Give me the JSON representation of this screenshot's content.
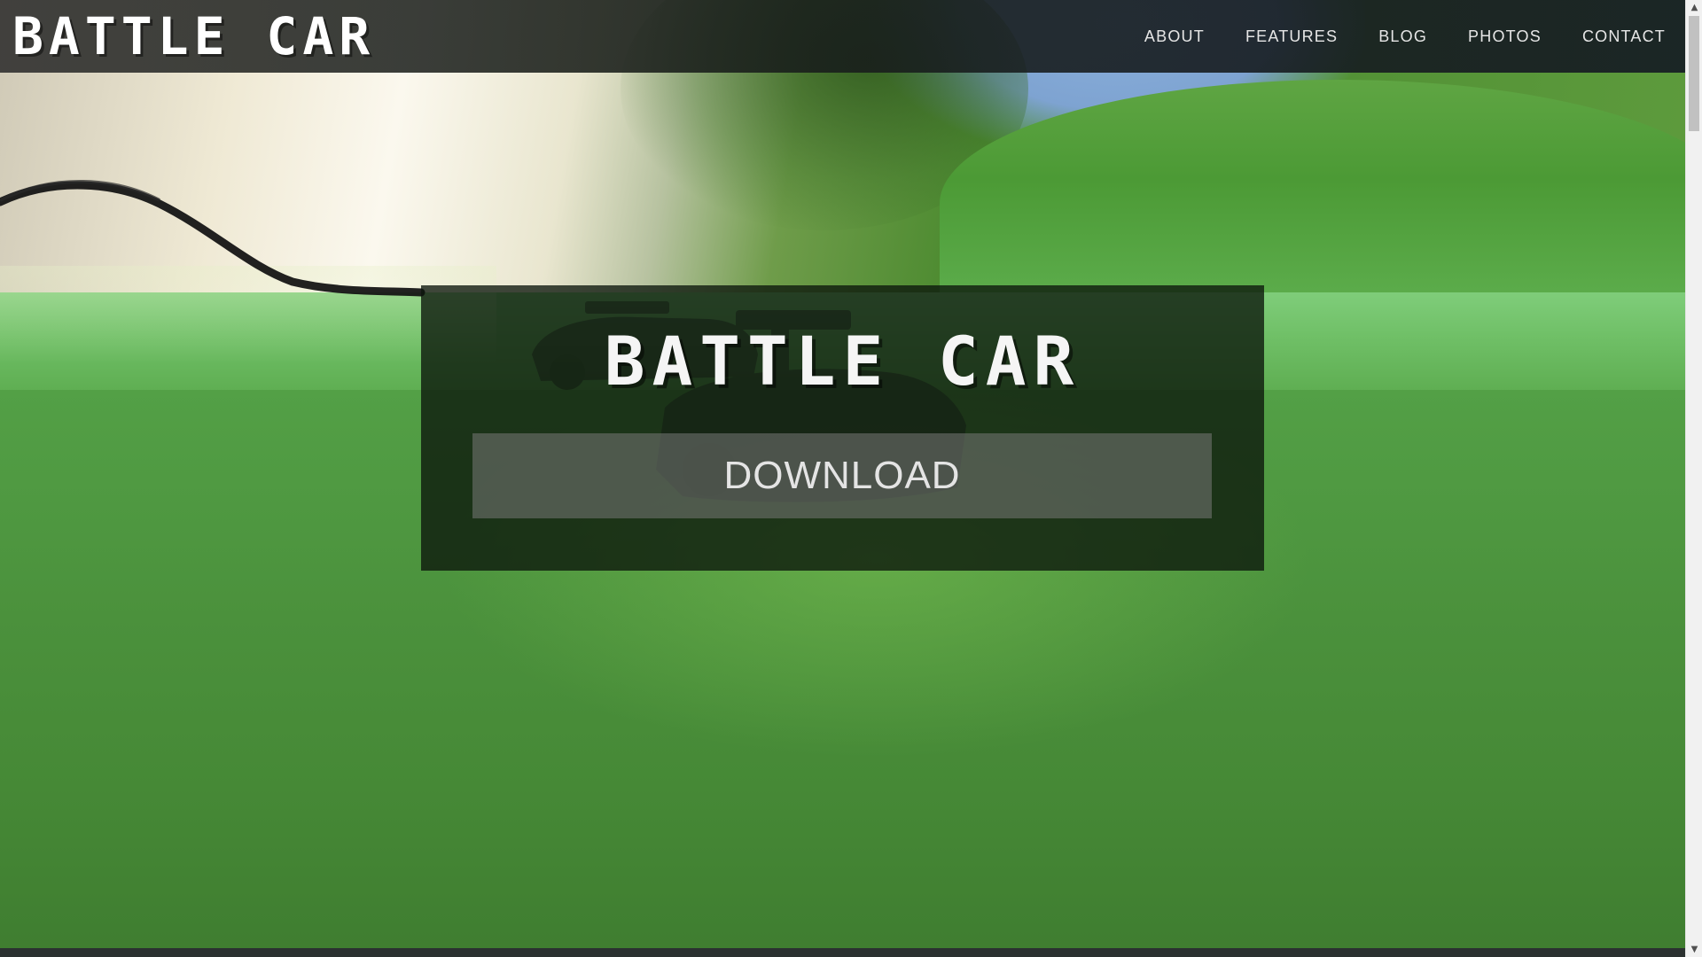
{
  "header": {
    "brand": "BATTLE CAR",
    "nav": [
      {
        "label": "ABOUT"
      },
      {
        "label": "FEATURES"
      },
      {
        "label": "BLOG"
      },
      {
        "label": "PHOTOS"
      },
      {
        "label": "CONTACT"
      }
    ]
  },
  "hero": {
    "title": "BATTLE CAR",
    "download_label": "DOWNLOAD"
  },
  "scrollbar": {
    "up_icon": "chevron-up-icon",
    "down_icon": "chevron-down-icon"
  },
  "colors": {
    "grass": "#4a8a3a",
    "navbar": "#1e221e",
    "hero_panel": "#0c160c",
    "button": "#787878"
  }
}
